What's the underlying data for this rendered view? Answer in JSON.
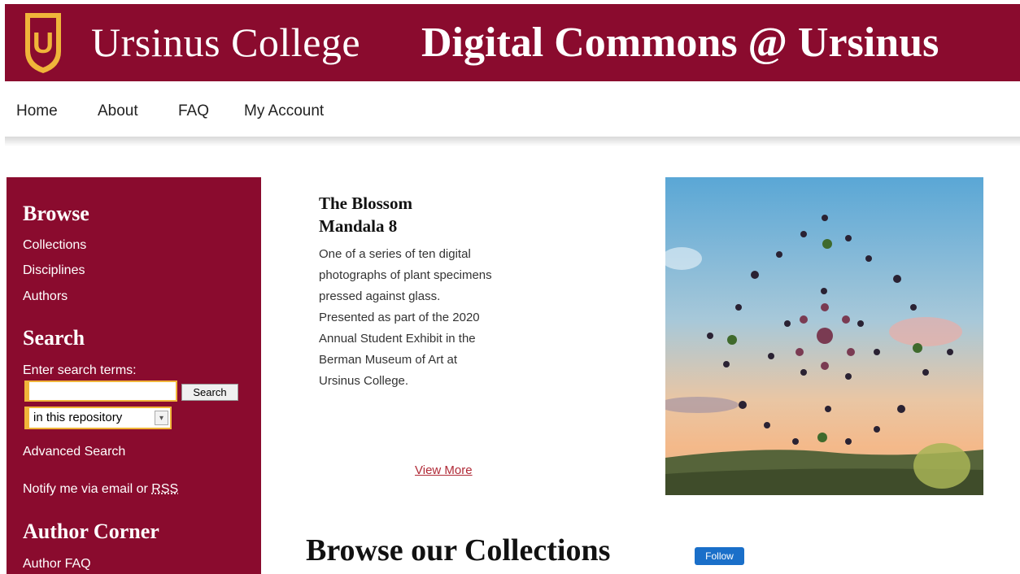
{
  "header": {
    "logo_letter": "U",
    "college_name": "Ursinus College",
    "site_title": "Digital Commons @ Ursinus"
  },
  "nav": {
    "items": [
      {
        "label": "Home"
      },
      {
        "label": "About"
      },
      {
        "label": "FAQ"
      },
      {
        "label": "My Account"
      }
    ]
  },
  "sidebar": {
    "browse_heading": "Browse",
    "browse_links": [
      "Collections",
      "Disciplines",
      "Authors"
    ],
    "search_heading": "Search",
    "search_prompt": "Enter search terms:",
    "search_value": "",
    "search_button": "Search",
    "scope_selected": "in this repository",
    "advanced_search": "Advanced Search",
    "notify_text": "Notify me via email or ",
    "rss_label": "RSS",
    "author_heading": "Author Corner",
    "author_links": [
      "Author FAQ"
    ]
  },
  "feature": {
    "title": "The Blossom Mandala 8",
    "description": "One of a series of ten digital photographs of plant specimens pressed against glass. Presented as part of the 2020 Annual Student Exhibit in the Berman Museum of Art at Ursinus College.",
    "view_more": "View More"
  },
  "collections": {
    "heading": "Browse our Collections",
    "follow_label": "Follow"
  },
  "colors": {
    "brand": "#8a0b2e",
    "gold": "#f0b53a",
    "follow": "#1a6fc9"
  }
}
